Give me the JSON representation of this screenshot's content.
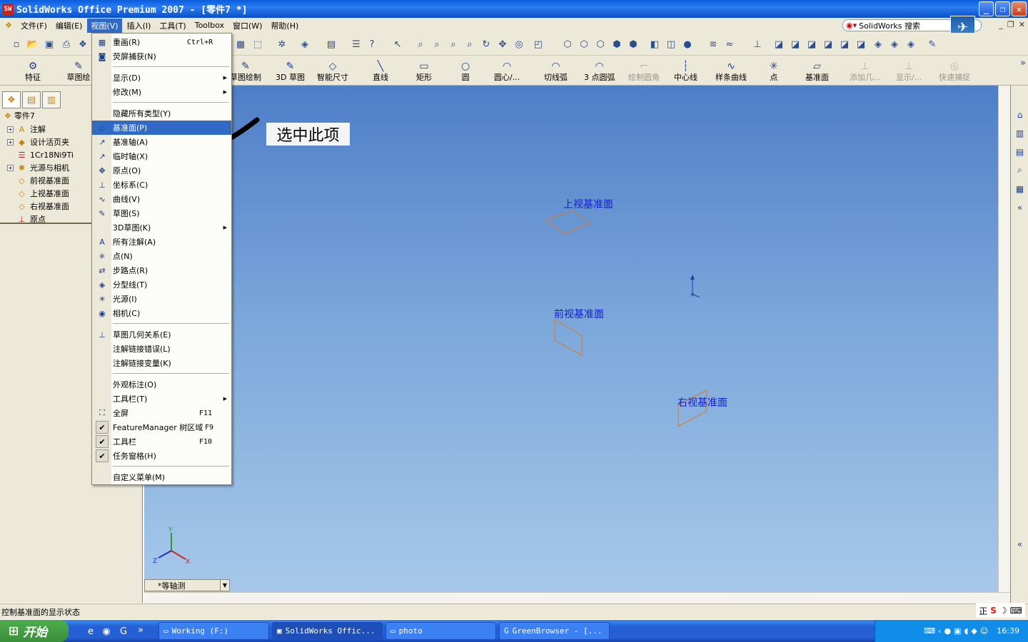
{
  "window": {
    "title": "SolidWorks Office Premium 2007 - [零件7 *]"
  },
  "menubar": {
    "items": [
      "文件(F)",
      "编辑(E)",
      "视图(V)",
      "插入(I)",
      "工具(T)",
      "Toolbox",
      "窗口(W)",
      "帮助(H)"
    ],
    "active_index": 2
  },
  "search": {
    "label": "SolidWorks 搜索"
  },
  "commandmanager": {
    "left_buttons": [
      "特征",
      "草图绘"
    ],
    "buttons": [
      {
        "label": "草图绘制",
        "icon": "sketch-icon"
      },
      {
        "label": "3D 草图",
        "icon": "3d-sketch-icon"
      },
      {
        "label": "智能尺寸",
        "icon": "smart-dimension-icon"
      },
      {
        "label": "直线",
        "icon": "line-icon"
      },
      {
        "label": "矩形",
        "icon": "rectangle-icon"
      },
      {
        "label": "圆",
        "icon": "circle-icon"
      },
      {
        "label": "圆心/...",
        "icon": "centerpoint-arc-icon"
      },
      {
        "label": "切线弧",
        "icon": "tangent-arc-icon"
      },
      {
        "label": "3 点圆弧",
        "icon": "three-point-arc-icon"
      },
      {
        "label": "绘制圆角",
        "icon": "sketch-fillet-icon",
        "disabled": true
      },
      {
        "label": "中心线",
        "icon": "centerline-icon"
      },
      {
        "label": "样条曲线",
        "icon": "spline-icon"
      },
      {
        "label": "点",
        "icon": "point-icon"
      },
      {
        "label": "基准面",
        "icon": "plane-icon"
      },
      {
        "label": "添加几...",
        "icon": "add-relation-icon",
        "disabled": true
      },
      {
        "label": "显示/...",
        "icon": "display-relations-icon",
        "disabled": true
      },
      {
        "label": "快速捕捉",
        "icon": "quick-snaps-icon",
        "disabled": true
      }
    ]
  },
  "feature_tree": {
    "root": "零件7",
    "nodes": [
      {
        "label": "注解",
        "expandable": true,
        "icon": "annotations-icon"
      },
      {
        "label": "设计活页夹",
        "expandable": true,
        "icon": "design-binder-icon"
      },
      {
        "label": "1Cr18Ni9Ti",
        "expandable": false,
        "icon": "material-icon"
      },
      {
        "label": "光源与相机",
        "expandable": true,
        "icon": "lights-cameras-icon"
      },
      {
        "label": "前视基准面",
        "expandable": false,
        "icon": "plane-icon"
      },
      {
        "label": "上视基准面",
        "expandable": false,
        "icon": "plane-icon"
      },
      {
        "label": "右视基准面",
        "expandable": false,
        "icon": "plane-icon"
      },
      {
        "label": "原点",
        "expandable": false,
        "icon": "origin-icon"
      }
    ]
  },
  "view_menu": {
    "items": [
      {
        "label": "重画(R)",
        "shortcut": "Ctrl+R",
        "icon": "redraw-icon"
      },
      {
        "label": "荧屏捕获(N)",
        "icon": "screen-capture-icon"
      },
      {
        "sep": true
      },
      {
        "label": "显示(D)",
        "submenu": true
      },
      {
        "label": "修改(M)",
        "submenu": true
      },
      {
        "sep": true
      },
      {
        "label": "隐藏所有类型(Y)"
      },
      {
        "label": "基准面(P)",
        "icon": "plane-icon",
        "highlighted": true
      },
      {
        "label": "基准轴(A)",
        "icon": "axis-icon"
      },
      {
        "label": "临时轴(X)",
        "icon": "temp-axis-icon"
      },
      {
        "label": "原点(O)",
        "icon": "origin-icon"
      },
      {
        "label": "坐标系(C)",
        "icon": "coordinate-system-icon"
      },
      {
        "label": "曲线(V)",
        "icon": "curve-icon"
      },
      {
        "label": "草图(S)",
        "icon": "sketch-icon"
      },
      {
        "label": "3D草图(K)",
        "submenu": true
      },
      {
        "label": "所有注解(A)",
        "icon": "annotation-icon"
      },
      {
        "label": "点(N)",
        "icon": "point-icon"
      },
      {
        "label": "步路点(R)",
        "icon": "route-point-icon"
      },
      {
        "label": "分型线(T)",
        "icon": "parting-line-icon"
      },
      {
        "label": "光源(I)",
        "icon": "light-icon"
      },
      {
        "label": "相机(C)",
        "icon": "camera-icon"
      },
      {
        "sep": true
      },
      {
        "label": "草图几何关系(E)",
        "icon": "sketch-relations-icon"
      },
      {
        "label": "注解链接错误(L)"
      },
      {
        "label": "注解链接变量(K)"
      },
      {
        "sep": true
      },
      {
        "label": "外观标注(O)"
      },
      {
        "label": "工具栏(T)",
        "submenu": true
      },
      {
        "label": "全屏",
        "shortcut": "F11",
        "icon": "fullscreen-icon"
      },
      {
        "label": "FeatureManager 树区域",
        "shortcut": "F9",
        "checked": true
      },
      {
        "label": "工具栏",
        "shortcut": "F10",
        "checked": true
      },
      {
        "label": "任务窗格(H)",
        "checked": true
      },
      {
        "sep": true
      },
      {
        "label": "自定义菜单(M)"
      }
    ]
  },
  "annotation": {
    "text": "选中此项"
  },
  "viewport": {
    "planes": {
      "top": "上视基准面",
      "front": "前视基准面",
      "right": "右视基准面"
    },
    "triad": {
      "x": "X",
      "y": "Y",
      "z": "Z"
    },
    "view_orientation": "*等轴测"
  },
  "status": {
    "text": "控制基准面的显示状态"
  },
  "ime": {
    "text": "正"
  },
  "taskbar": {
    "start": "开始",
    "tasks": [
      "Working (F:)",
      "SolidWorks Offic...",
      "photo",
      "GreenBrowser - [..."
    ],
    "active_task": 1,
    "clock": "16:39"
  },
  "colors": {
    "highlight": "#316ac5",
    "plane_outline": "#e07820",
    "plane_label": "#1020c8"
  }
}
